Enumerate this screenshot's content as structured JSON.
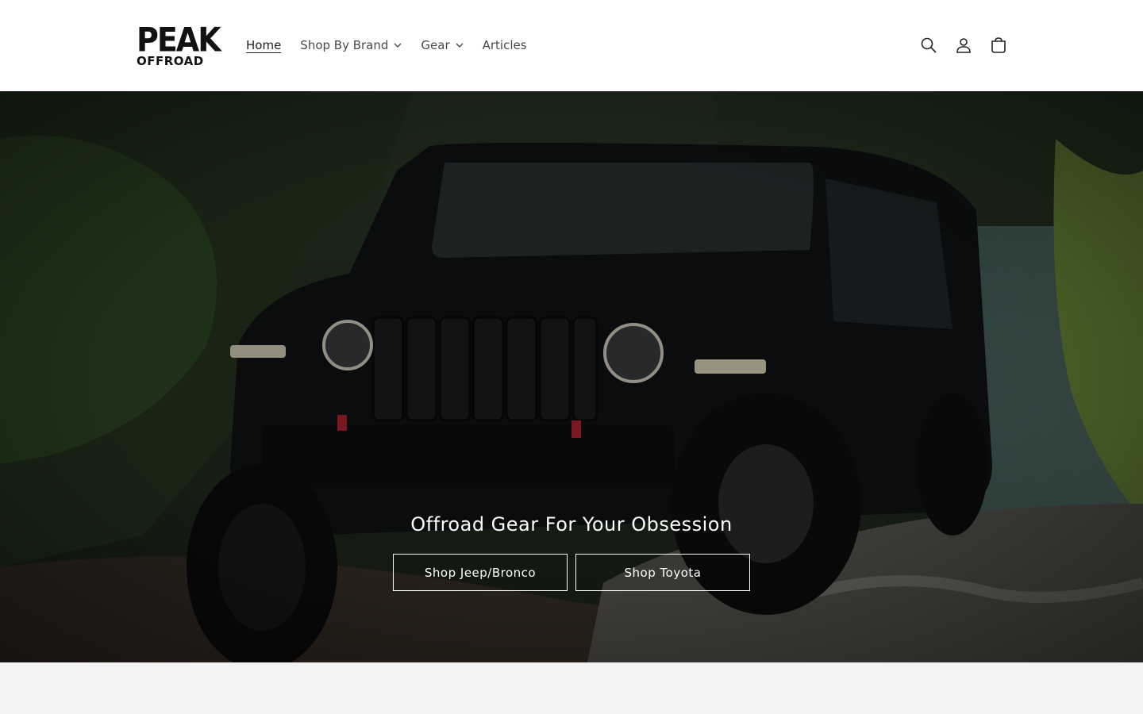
{
  "brand": {
    "logo_line1": "PEAK",
    "logo_line2": "OFFROAD"
  },
  "nav": {
    "items": [
      {
        "label": "Home",
        "active": true
      },
      {
        "label": "Shop By Brand",
        "has_dropdown": true
      },
      {
        "label": "Gear",
        "has_dropdown": true
      },
      {
        "label": "Articles"
      }
    ]
  },
  "header_icons": [
    "search-icon",
    "account-icon",
    "cart-icon"
  ],
  "hero": {
    "title": "Offroad Gear For Your Obsession",
    "buttons": [
      {
        "label": "Shop Jeep/Bronco"
      },
      {
        "label": "Shop Toyota"
      }
    ]
  },
  "colors": {
    "header_bg": "#ffffff",
    "page_bg": "#f3f3f3",
    "hero_text": "#ffffff"
  }
}
